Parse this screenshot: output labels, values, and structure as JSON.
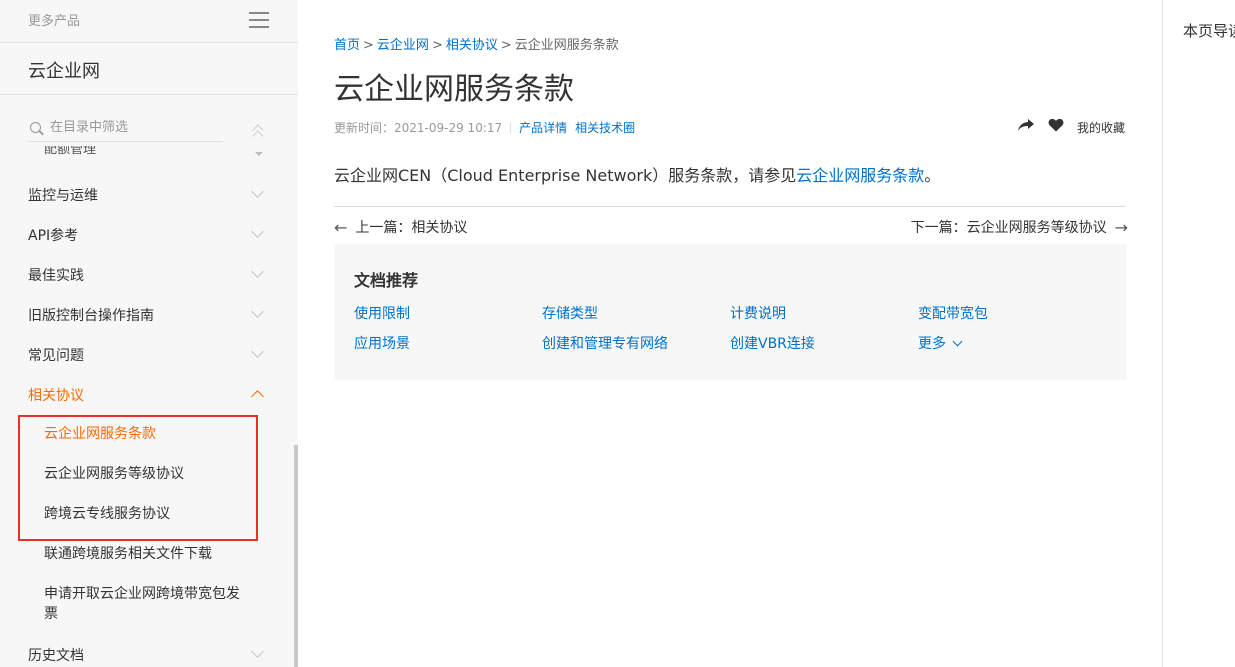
{
  "sidebar": {
    "more_products": "更多产品",
    "product_name": "云企业网",
    "search_placeholder": "在目录中筛选",
    "partial_item": "配额管理",
    "items": [
      {
        "label": "监控与运维"
      },
      {
        "label": "API参考"
      },
      {
        "label": "最佳实践"
      },
      {
        "label": "旧版控制台操作指南"
      },
      {
        "label": "常见问题"
      },
      {
        "label": "相关协议"
      },
      {
        "label": "历史文档"
      }
    ],
    "sub_items": [
      {
        "label": "云企业网服务条款"
      },
      {
        "label": "云企业网服务等级协议"
      },
      {
        "label": "跨境云专线服务协议"
      },
      {
        "label": "联通跨境服务相关文件下载"
      },
      {
        "label": "申请开取云企业网跨境带宽包发票"
      }
    ]
  },
  "breadcrumb": {
    "home": "首页",
    "product": "云企业网",
    "section": "相关协议",
    "current": "云企业网服务条款"
  },
  "page": {
    "title": "云企业网服务条款",
    "updated": "更新时间：2021-09-29 10:17",
    "product_detail": "产品详情",
    "tech_circle": "相关技术圈",
    "favorite": "我的收藏"
  },
  "content": {
    "text_before": "云企业网CEN（Cloud Enterprise Network）服务条款，请参见",
    "link": "云企业网服务条款",
    "text_after": "。"
  },
  "pager": {
    "prev": "上一篇：相关协议",
    "next": "下一篇：云企业网服务等级协议"
  },
  "recommend": {
    "title": "文档推荐",
    "links": [
      "使用限制",
      "存储类型",
      "计费说明",
      "变配带宽包",
      "应用场景",
      "创建和管理专有网络",
      "创建VBR连接"
    ],
    "more": "更多"
  },
  "toc": {
    "title": "本页导读"
  }
}
